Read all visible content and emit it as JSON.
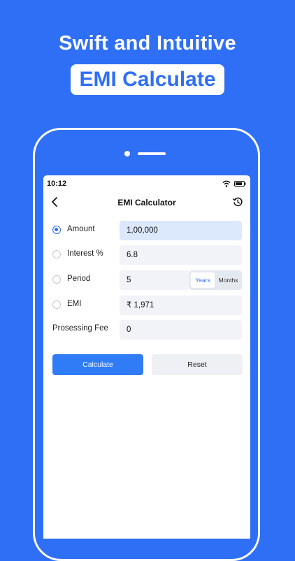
{
  "promo": {
    "headline": "Swift and Intuitive",
    "badge": "EMI Calculate"
  },
  "status_bar": {
    "time": "10:12"
  },
  "app_bar": {
    "title": "EMI Calculator",
    "back_icon": "chevron-left-icon",
    "history_icon": "history-icon"
  },
  "form": {
    "amount": {
      "label": "Amount",
      "value": "1,00,000",
      "selected": true
    },
    "interest": {
      "label": "Interest %",
      "value": "6.8",
      "selected": false
    },
    "period": {
      "label": "Period",
      "value": "5",
      "unit_options": [
        "Years",
        "Months"
      ],
      "unit_selected": "Years",
      "selected": false
    },
    "emi": {
      "label": "EMI",
      "value": "₹ 1,971",
      "selected": false
    },
    "processing_fee": {
      "label": "Prosessing Fee",
      "value": "0"
    }
  },
  "buttons": {
    "calculate": "Calculate",
    "reset": "Reset"
  },
  "colors": {
    "background": "#2f6ff5",
    "accent": "#2f7cf6",
    "active_field": "#dce8fb",
    "field": "#f1f3f8"
  }
}
